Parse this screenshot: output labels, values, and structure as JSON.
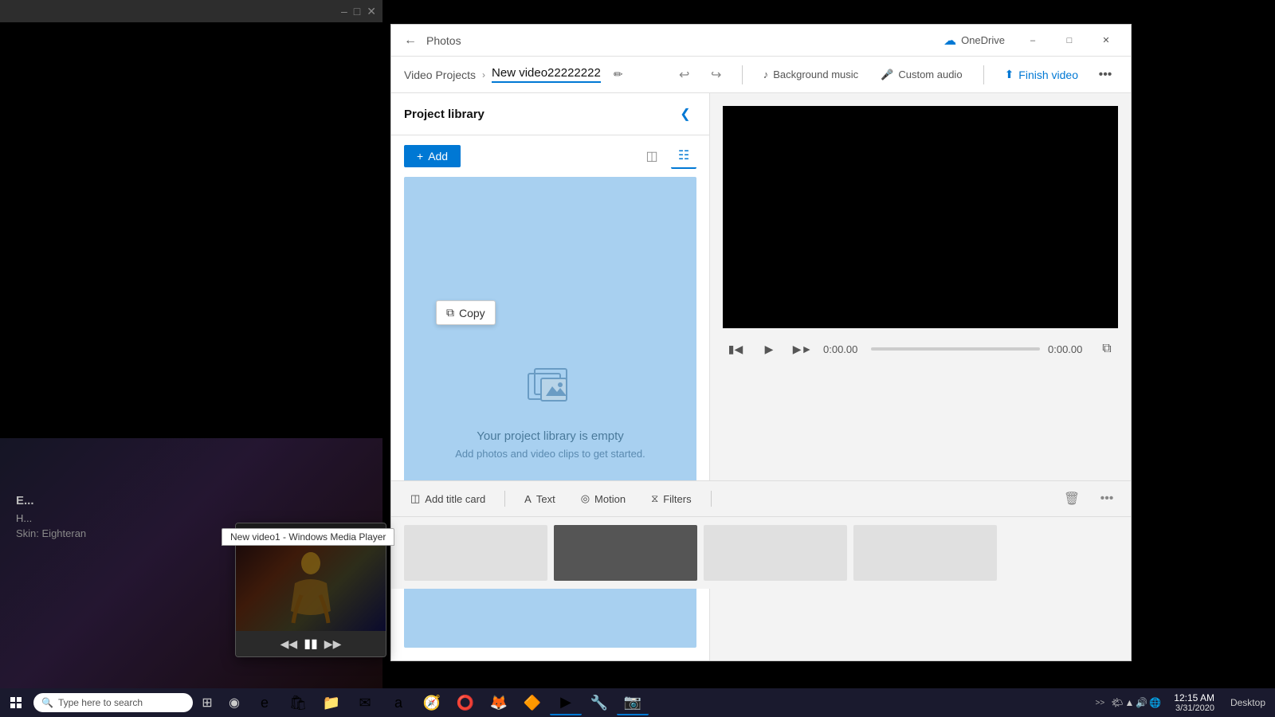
{
  "desktop": {
    "bg": "black"
  },
  "titleBar": {
    "appName": "Photos",
    "oneDriveLabel": "OneDrive",
    "minimizeLabel": "Minimize",
    "maximizeLabel": "Maximize",
    "closeLabel": "Close"
  },
  "toolbar": {
    "breadcrumb": {
      "parent": "Video Projects",
      "current": "New video22222222"
    },
    "editIcon": "✏",
    "undoIcon": "↩",
    "redoIcon": "↪",
    "backgroundMusic": "Background music",
    "customAudio": "Custom audio",
    "finishVideo": "Finish video",
    "moreIcon": "•••"
  },
  "leftPanel": {
    "title": "Project library",
    "addLabel": "+ Add",
    "collapseIcon": "❮",
    "viewGrid1": "⊞",
    "viewGrid2": "⊟",
    "emptyIcon": "🖼",
    "emptyTitle": "Your project library is empty",
    "emptySub": "Add photos and video clips to get started."
  },
  "copyTooltip": {
    "icon": "⧉",
    "label": "Copy"
  },
  "videoControls": {
    "rewindIcon": "⏮",
    "playIcon": "▶",
    "fastForwardIcon": "⏭",
    "timeStart": "0:00.00",
    "timeEnd": "0:00.00",
    "expandIcon": "⤢"
  },
  "timelineToolbar": {
    "addTitleCard": "Add title card",
    "text": "Text",
    "motion": "Motion",
    "filters": "Filters",
    "textIcon": "A",
    "motionIcon": "◎",
    "filtersIcon": "⧖",
    "trashIcon": "🗑",
    "moreIcon": "•••"
  },
  "wmpPopup": {
    "windowTitle": "New video1 - Windows Media Player",
    "appName": "Windows Media Player",
    "prevIcon": "⏮",
    "pauseIcon": "⏸",
    "nextIcon": "⏭"
  },
  "taskbar": {
    "searchPlaceholder": "Type here to search",
    "desktopLabel": "Desktop",
    "time": "12:15 AM",
    "date": "3/31/2020",
    "chevronLabel": ">>",
    "apps": [
      "🌐",
      "🔍",
      "E",
      "🛒",
      "📁",
      "📧",
      "a",
      "🧭",
      "⭕",
      "🦊",
      "🎵",
      "▶",
      "🔧",
      "📷"
    ]
  }
}
